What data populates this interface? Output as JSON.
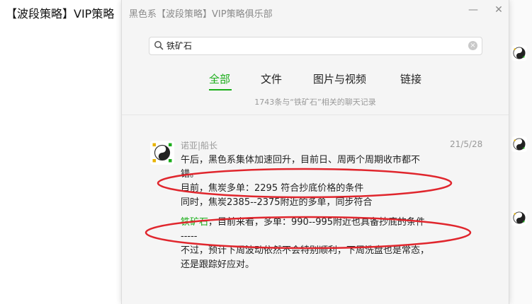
{
  "background_chat": {
    "title": "【波段策略】VIP策略"
  },
  "dialog": {
    "title": "黑色系【波段策略】VIP策略俱乐部",
    "minimize_glyph": "—",
    "close_glyph": "✕"
  },
  "search": {
    "value": "铁矿石",
    "clear_glyph": "×"
  },
  "tabs": [
    {
      "label": "全部",
      "active": true
    },
    {
      "label": "文件",
      "active": false
    },
    {
      "label": "图片与视频",
      "active": false
    },
    {
      "label": "链接",
      "active": false
    }
  ],
  "result_count": "1743条与“铁矿石”相关的聊天记录",
  "message": {
    "sender": "诺亚|船长",
    "date": "21/5/28",
    "lines": {
      "l1": "午后，黑色系集体加速回升，目前日、周两个周期收市都不错。",
      "l2": "目前，焦炭多单：2295 符合抄底价格的条件",
      "l3": "同时，焦炭2385--2375附近的多单，同步符合",
      "l4_highlight": "铁矿石",
      "l4_rest": "，目前来看，多单：990--995附近也具备抄底的条件",
      "l5": "-----",
      "l6": "不过，预计下周波动依然不会特别顺利，下周洗盘也是常态，还是跟踪好应对。"
    }
  },
  "colors": {
    "accent_green": "#1aad19",
    "annotation_red": "#e0262d"
  },
  "icons": [
    "search-icon",
    "clear-icon",
    "minimize-icon",
    "close-icon",
    "yin-yang-avatar-icon"
  ]
}
